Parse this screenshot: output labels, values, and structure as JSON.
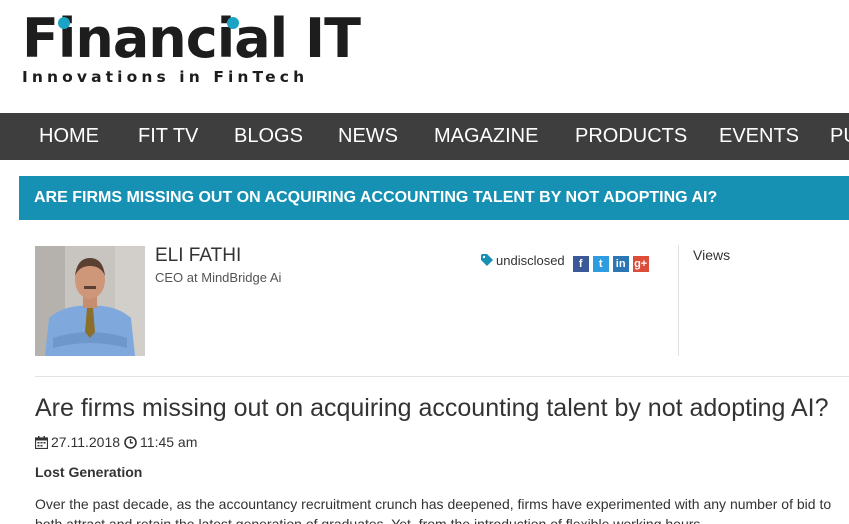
{
  "logo": {
    "name": "Financial IT",
    "tagline": "Innovations in FinTech"
  },
  "nav": {
    "items": [
      "HOME",
      "FIT TV",
      "BLOGS",
      "NEWS",
      "MAGAZINE",
      "PRODUCTS",
      "EVENTS",
      "PU"
    ]
  },
  "title_bar": {
    "text": "ARE FIRMS MISSING OUT ON ACQUIRING ACCOUNTING TALENT BY NOT ADOPTING AI?"
  },
  "author": {
    "name": "ELI FATHI",
    "role": "CEO at MindBridge Ai"
  },
  "tag": {
    "label": "undisclosed"
  },
  "social": {
    "facebook": "f",
    "twitter": "t",
    "linkedin": "in",
    "googleplus": "g+"
  },
  "views": {
    "label": "Views"
  },
  "article": {
    "title": "Are firms missing out on acquiring accounting talent by not adopting AI?",
    "date": "27.11.2018",
    "time": "11:45 am",
    "section_heading": "Lost Generation",
    "paragraph": "Over the past decade, as the accountancy recruitment crunch has deepened, firms have experimented with any number of bid to both attract and retain the latest generation of graduates. Yet, from the introduction of flexible working hours"
  },
  "colors": {
    "accent": "#1691b4",
    "nav_bg": "#3e3e3e",
    "logo_dot": "#1aa3c4"
  }
}
